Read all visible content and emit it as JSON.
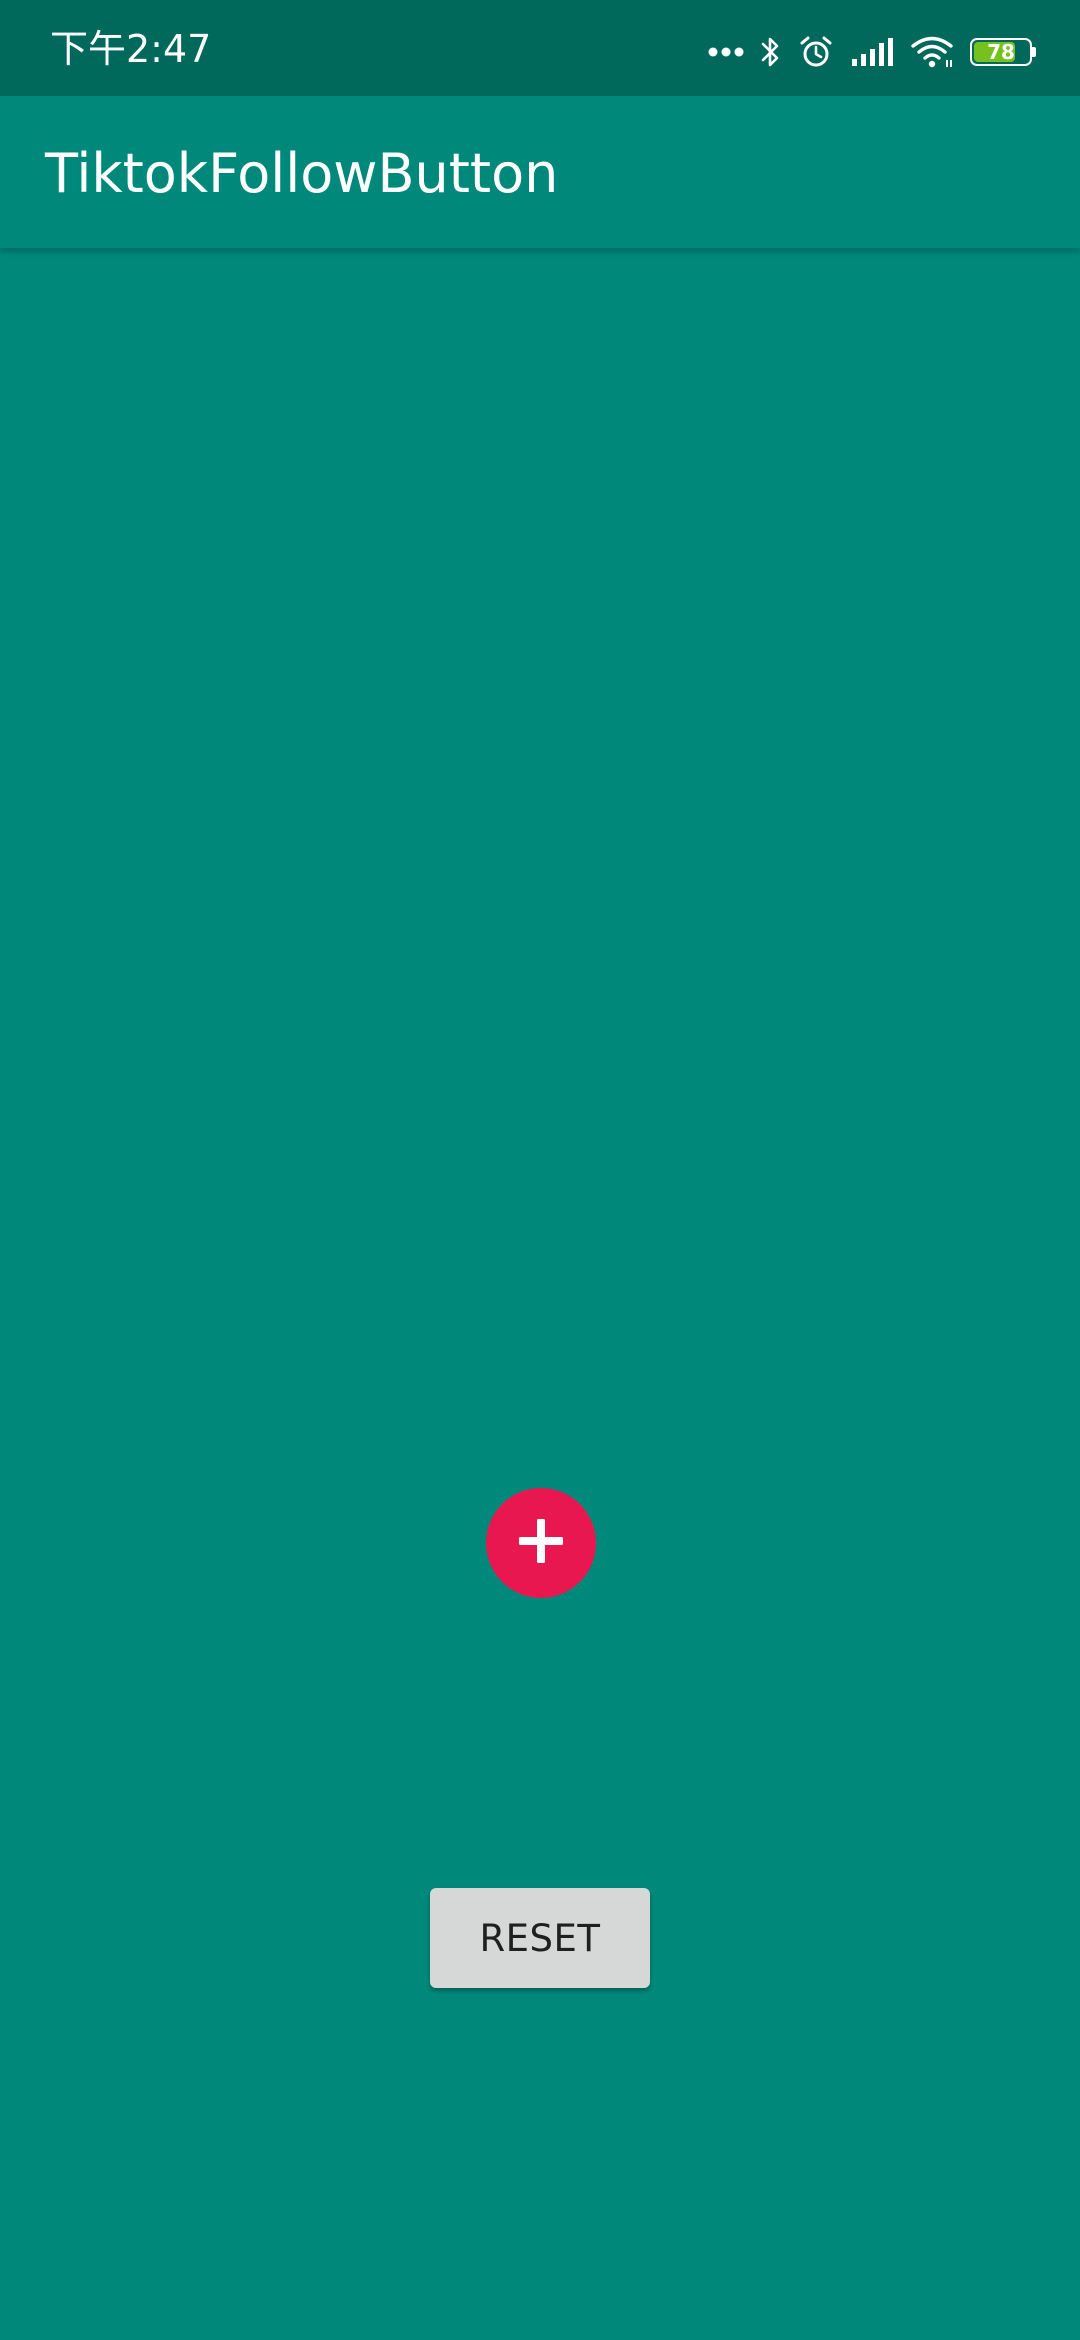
{
  "status_bar": {
    "time": "下午2:47",
    "battery_level": 78,
    "battery_label": "78",
    "icons": [
      "more-dots-icon",
      "bluetooth-icon",
      "alarm-icon",
      "signal-icon",
      "wifi-icon",
      "battery-icon"
    ]
  },
  "app_bar": {
    "title": "TiktokFollowButton"
  },
  "main": {
    "follow_button_icon": "plus-icon",
    "reset_label": "RESET"
  },
  "colors": {
    "primary": "#00897B",
    "primary_dark": "#00695C",
    "accent": "#E8174F",
    "button": "#D6D7D7",
    "battery_fill": "#76C11F"
  }
}
